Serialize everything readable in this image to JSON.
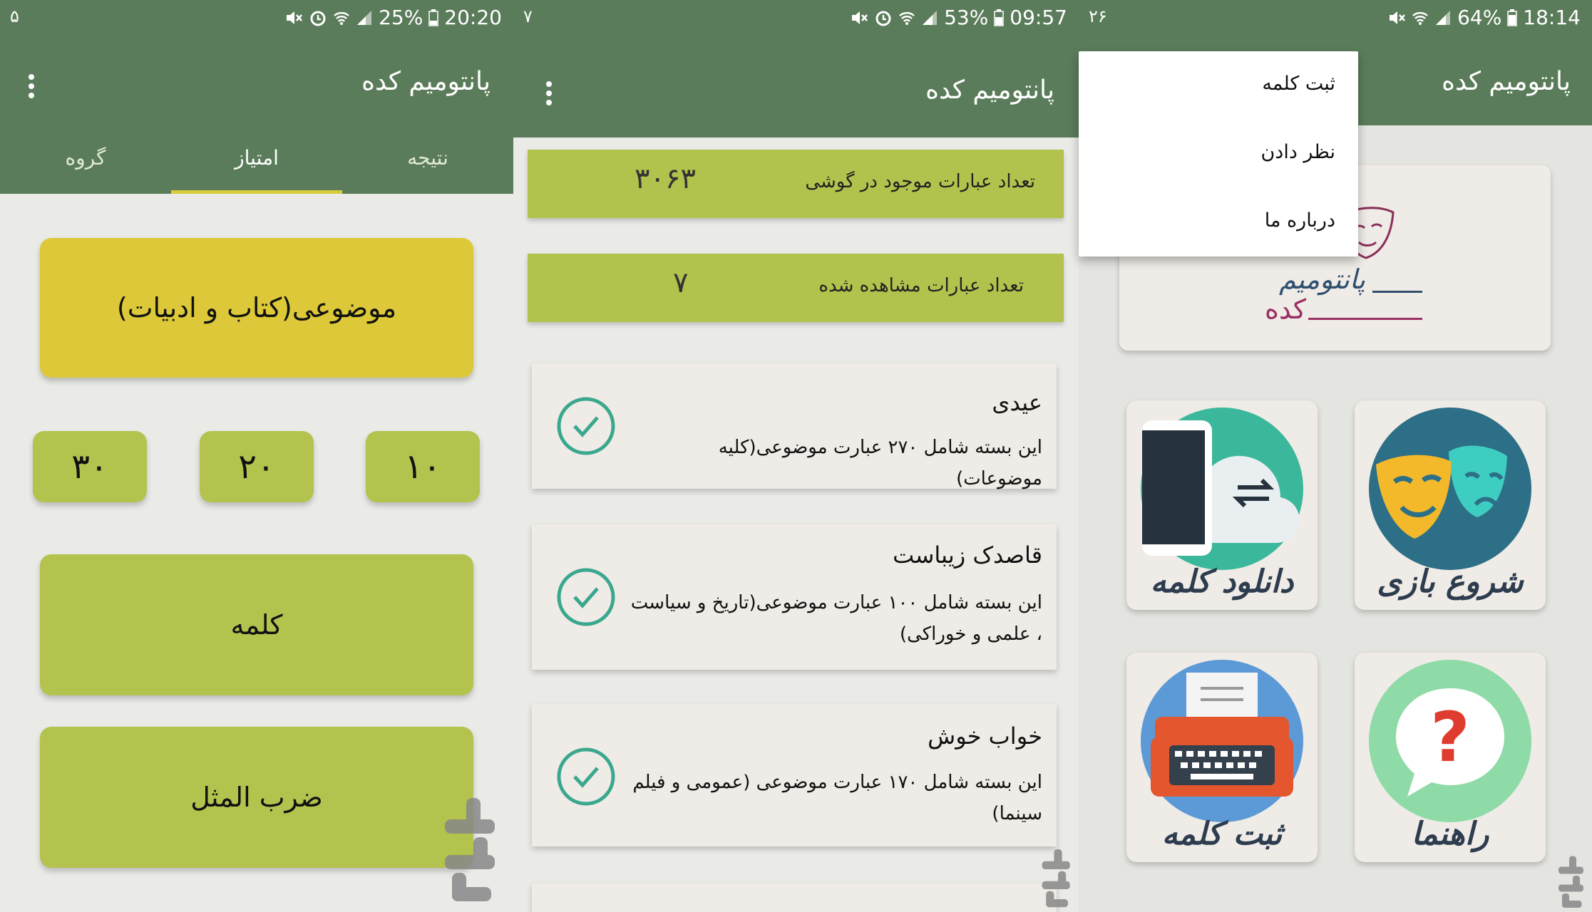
{
  "colors": {
    "appbar": "#5b7c5b",
    "tab_indicator": "#d8cc3c",
    "yellow_card": "#dcc838",
    "green_card": "#b3c34e",
    "check": "#3aa88e"
  },
  "screen1": {
    "status": {
      "left": "۵",
      "battery": "25%",
      "time": "20:20"
    },
    "title": "پانتومیم کده",
    "tabs": [
      "نتیجه",
      "امتیاز",
      "گروه"
    ],
    "active_tab": "امتیاز",
    "category": "موضوعی(کتاب و ادبیات)",
    "scores": [
      "۱۰",
      "۲۰",
      "۳۰"
    ],
    "types": [
      "کلمه",
      "ضرب المثل"
    ]
  },
  "screen2": {
    "status": {
      "left": "۷",
      "battery": "53%",
      "time": "09:57"
    },
    "title": "پانتومیم کده",
    "stats": [
      {
        "label": "تعداد عبارات موجود در گوشی",
        "value": "۳۰۶۳"
      },
      {
        "label": "تعداد عبارات مشاهده شده",
        "value": "۷"
      }
    ],
    "packs": [
      {
        "title": "عیدی",
        "desc": "این بسته شامل ۲۷۰ عبارت موضوعی(کلیه موضوعات)"
      },
      {
        "title": "قاصدک زیباست",
        "desc": "این بسته شامل ۱۰۰ عبارت موضوعی(تاریخ و سیاست ، علمی و خوراکی)"
      },
      {
        "title": "خواب خوش",
        "desc": "این بسته شامل ۱۷۰ عبارت موضوعی (عمومی و فیلم سینما)"
      }
    ]
  },
  "screen3": {
    "status": {
      "left": "۲۶",
      "battery": "64%",
      "time": "18:14"
    },
    "title": "پانتومیم کده",
    "menu": [
      "ثبت کلمه",
      "نظر دادن",
      "درباره ما"
    ],
    "logo_text": {
      "top": "پانتومیم",
      "bottom": "کده"
    },
    "tiles": [
      {
        "label": "شروع بازی",
        "icon": "theater-masks-icon"
      },
      {
        "label": "دانلود کلمه",
        "icon": "phone-cloud-sync-icon"
      },
      {
        "label": "راهنما",
        "icon": "question-bubble-icon"
      },
      {
        "label": "ثبت کلمه",
        "icon": "typewriter-icon"
      }
    ]
  }
}
